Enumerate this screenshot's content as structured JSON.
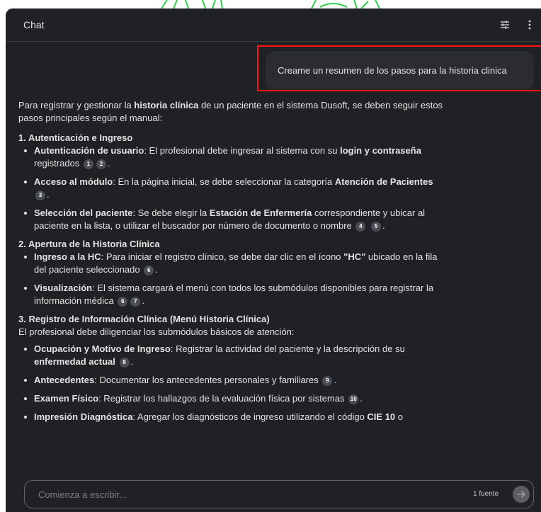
{
  "header": {
    "title": "Chat",
    "icons": [
      "tune-icon",
      "more-vert-icon"
    ]
  },
  "user_message": "Creame un resumen de los pasos para la historia clinica",
  "response": {
    "intro": {
      "a": "Para registrar y gestionar la ",
      "b": "historia clínica",
      "c": " de un paciente en el sistema Dusoft, se deben seguir estos pasos principales según el manual:"
    },
    "s1": {
      "title": "1. Autenticación e Ingreso",
      "i1": {
        "a": "Autenticación de usuario",
        "b": ": El profesional debe ingresar al sistema con su ",
        "c": "login y contraseña",
        "d": " registrados",
        "e": "."
      },
      "i2": {
        "a": "Acceso al módulo",
        "b": ": En la página inicial, se debe seleccionar la categoría ",
        "c": "Atención de Pacientes",
        "d": "."
      },
      "i3": {
        "a": "Selección del paciente",
        "b": ": Se debe elegir la ",
        "c": "Estación de Enfermería",
        "d": " correspondiente y ubicar al paciente en la lista, o utilizar el buscador por número de documento o nombre",
        "e": "."
      }
    },
    "s2": {
      "title": "2. Apertura de la Historia Clínica",
      "i1": {
        "a": "Ingreso a la HC",
        "b": ": Para iniciar el registro clínico, se debe dar clic en el ícono ",
        "c": "\"HC\"",
        "d": " ubicado en la fila del paciente seleccionado",
        "e": "."
      },
      "i2": {
        "a": "Visualización",
        "b": ": El sistema cargará el menú con todos los submódulos disponibles para registrar la información médica",
        "c": "."
      }
    },
    "s3": {
      "title": "3. Registro de Información Clínica (Menú Historia Clínica)",
      "intro": "El profesional debe diligenciar los submódulos básicos de atención:",
      "i1": {
        "a": "Ocupación y Motivo de Ingreso",
        "b": ": Registrar la actividad del paciente y la descripción de su ",
        "c": "enfermedad actual",
        "d": "."
      },
      "i2": {
        "a": "Antecedentes",
        "b": ": Documentar los antecedentes personales y familiares",
        "c": "."
      },
      "i3": {
        "a": "Examen Físico",
        "b": ": Registrar los hallazgos de la evaluación física por sistemas",
        "c": "."
      },
      "i4": {
        "a": "Impresión Diagnóstica",
        "b": ": Agregar los diagnósticos de ingreso utilizando el código ",
        "c": "CIE 10",
        "d": " o"
      }
    },
    "citations": {
      "c1": "1",
      "c2": "2",
      "c3": "3",
      "c4": "4",
      "c5": "5",
      "c6": "6",
      "c7": "7",
      "c8": "8",
      "c9": "9",
      "c10": "10"
    }
  },
  "composer": {
    "placeholder": "Comienza a escribir...",
    "sources": "1 fuente",
    "send_icon": "arrow-right-icon"
  },
  "colors": {
    "background": "#202124",
    "bubble": "#2b2c30",
    "highlight": "#ff1010",
    "citation": "#4a4c56"
  }
}
